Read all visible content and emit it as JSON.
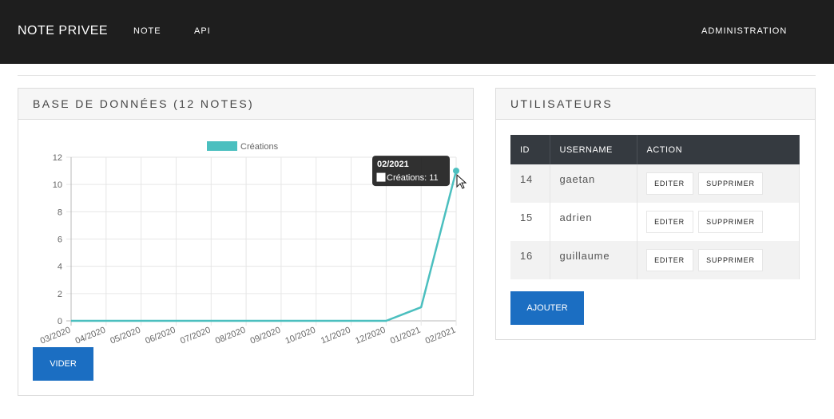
{
  "navbar": {
    "brand": "NOTE PRIVEE",
    "links": [
      "NOTE",
      "API"
    ],
    "admin": "ADMINISTRATION"
  },
  "db_panel": {
    "title": "BASE DE DONNÉES (12 NOTES)",
    "clear_button": "VIDER"
  },
  "chart_data": {
    "type": "line",
    "legend_position": "top",
    "grid": true,
    "color": "#4bbfbf",
    "x": [
      "03/2020",
      "04/2020",
      "05/2020",
      "06/2020",
      "07/2020",
      "08/2020",
      "09/2020",
      "10/2020",
      "11/2020",
      "12/2020",
      "01/2021",
      "02/2021"
    ],
    "series": [
      {
        "name": "Créations",
        "values": [
          0,
          0,
          0,
          0,
          0,
          0,
          0,
          0,
          0,
          0,
          1,
          11
        ]
      }
    ],
    "ylim": [
      0,
      12
    ],
    "yticks": [
      "0",
      "2",
      "4",
      "6",
      "8",
      "10",
      "12"
    ],
    "tooltip": {
      "title": "02/2021",
      "label": "Créations: 11"
    }
  },
  "users_panel": {
    "title": "UTILISATEURS",
    "headers": [
      "ID",
      "USERNAME",
      "ACTION"
    ],
    "rows": [
      {
        "id": "14",
        "username": "gaetan"
      },
      {
        "id": "15",
        "username": "adrien"
      },
      {
        "id": "16",
        "username": "guillaume"
      }
    ],
    "edit_label": "EDITER",
    "delete_label": "SUPPRIMER",
    "add_button": "AJOUTER"
  }
}
